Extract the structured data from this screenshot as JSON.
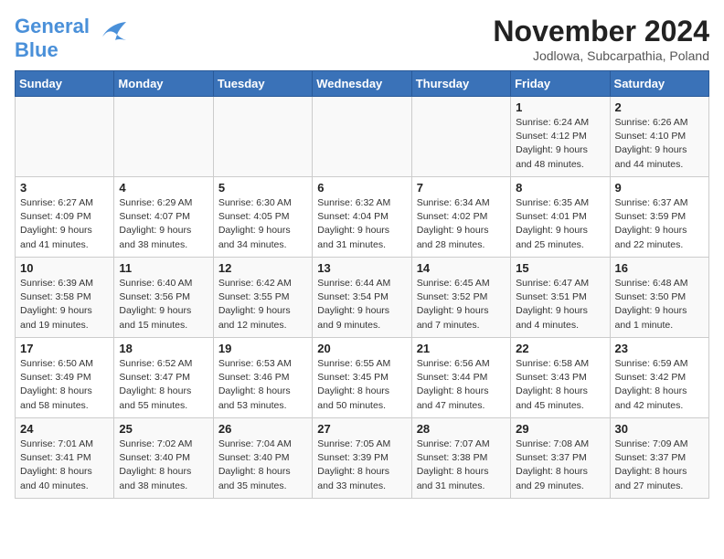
{
  "logo": {
    "general": "General",
    "blue": "Blue"
  },
  "title": "November 2024",
  "subtitle": "Jodlowa, Subcarpathia, Poland",
  "days_header": [
    "Sunday",
    "Monday",
    "Tuesday",
    "Wednesday",
    "Thursday",
    "Friday",
    "Saturday"
  ],
  "weeks": [
    [
      {
        "day": "",
        "info": ""
      },
      {
        "day": "",
        "info": ""
      },
      {
        "day": "",
        "info": ""
      },
      {
        "day": "",
        "info": ""
      },
      {
        "day": "",
        "info": ""
      },
      {
        "day": "1",
        "info": "Sunrise: 6:24 AM\nSunset: 4:12 PM\nDaylight: 9 hours\nand 48 minutes."
      },
      {
        "day": "2",
        "info": "Sunrise: 6:26 AM\nSunset: 4:10 PM\nDaylight: 9 hours\nand 44 minutes."
      }
    ],
    [
      {
        "day": "3",
        "info": "Sunrise: 6:27 AM\nSunset: 4:09 PM\nDaylight: 9 hours\nand 41 minutes."
      },
      {
        "day": "4",
        "info": "Sunrise: 6:29 AM\nSunset: 4:07 PM\nDaylight: 9 hours\nand 38 minutes."
      },
      {
        "day": "5",
        "info": "Sunrise: 6:30 AM\nSunset: 4:05 PM\nDaylight: 9 hours\nand 34 minutes."
      },
      {
        "day": "6",
        "info": "Sunrise: 6:32 AM\nSunset: 4:04 PM\nDaylight: 9 hours\nand 31 minutes."
      },
      {
        "day": "7",
        "info": "Sunrise: 6:34 AM\nSunset: 4:02 PM\nDaylight: 9 hours\nand 28 minutes."
      },
      {
        "day": "8",
        "info": "Sunrise: 6:35 AM\nSunset: 4:01 PM\nDaylight: 9 hours\nand 25 minutes."
      },
      {
        "day": "9",
        "info": "Sunrise: 6:37 AM\nSunset: 3:59 PM\nDaylight: 9 hours\nand 22 minutes."
      }
    ],
    [
      {
        "day": "10",
        "info": "Sunrise: 6:39 AM\nSunset: 3:58 PM\nDaylight: 9 hours\nand 19 minutes."
      },
      {
        "day": "11",
        "info": "Sunrise: 6:40 AM\nSunset: 3:56 PM\nDaylight: 9 hours\nand 15 minutes."
      },
      {
        "day": "12",
        "info": "Sunrise: 6:42 AM\nSunset: 3:55 PM\nDaylight: 9 hours\nand 12 minutes."
      },
      {
        "day": "13",
        "info": "Sunrise: 6:44 AM\nSunset: 3:54 PM\nDaylight: 9 hours\nand 9 minutes."
      },
      {
        "day": "14",
        "info": "Sunrise: 6:45 AM\nSunset: 3:52 PM\nDaylight: 9 hours\nand 7 minutes."
      },
      {
        "day": "15",
        "info": "Sunrise: 6:47 AM\nSunset: 3:51 PM\nDaylight: 9 hours\nand 4 minutes."
      },
      {
        "day": "16",
        "info": "Sunrise: 6:48 AM\nSunset: 3:50 PM\nDaylight: 9 hours\nand 1 minute."
      }
    ],
    [
      {
        "day": "17",
        "info": "Sunrise: 6:50 AM\nSunset: 3:49 PM\nDaylight: 8 hours\nand 58 minutes."
      },
      {
        "day": "18",
        "info": "Sunrise: 6:52 AM\nSunset: 3:47 PM\nDaylight: 8 hours\nand 55 minutes."
      },
      {
        "day": "19",
        "info": "Sunrise: 6:53 AM\nSunset: 3:46 PM\nDaylight: 8 hours\nand 53 minutes."
      },
      {
        "day": "20",
        "info": "Sunrise: 6:55 AM\nSunset: 3:45 PM\nDaylight: 8 hours\nand 50 minutes."
      },
      {
        "day": "21",
        "info": "Sunrise: 6:56 AM\nSunset: 3:44 PM\nDaylight: 8 hours\nand 47 minutes."
      },
      {
        "day": "22",
        "info": "Sunrise: 6:58 AM\nSunset: 3:43 PM\nDaylight: 8 hours\nand 45 minutes."
      },
      {
        "day": "23",
        "info": "Sunrise: 6:59 AM\nSunset: 3:42 PM\nDaylight: 8 hours\nand 42 minutes."
      }
    ],
    [
      {
        "day": "24",
        "info": "Sunrise: 7:01 AM\nSunset: 3:41 PM\nDaylight: 8 hours\nand 40 minutes."
      },
      {
        "day": "25",
        "info": "Sunrise: 7:02 AM\nSunset: 3:40 PM\nDaylight: 8 hours\nand 38 minutes."
      },
      {
        "day": "26",
        "info": "Sunrise: 7:04 AM\nSunset: 3:40 PM\nDaylight: 8 hours\nand 35 minutes."
      },
      {
        "day": "27",
        "info": "Sunrise: 7:05 AM\nSunset: 3:39 PM\nDaylight: 8 hours\nand 33 minutes."
      },
      {
        "day": "28",
        "info": "Sunrise: 7:07 AM\nSunset: 3:38 PM\nDaylight: 8 hours\nand 31 minutes."
      },
      {
        "day": "29",
        "info": "Sunrise: 7:08 AM\nSunset: 3:37 PM\nDaylight: 8 hours\nand 29 minutes."
      },
      {
        "day": "30",
        "info": "Sunrise: 7:09 AM\nSunset: 3:37 PM\nDaylight: 8 hours\nand 27 minutes."
      }
    ]
  ]
}
